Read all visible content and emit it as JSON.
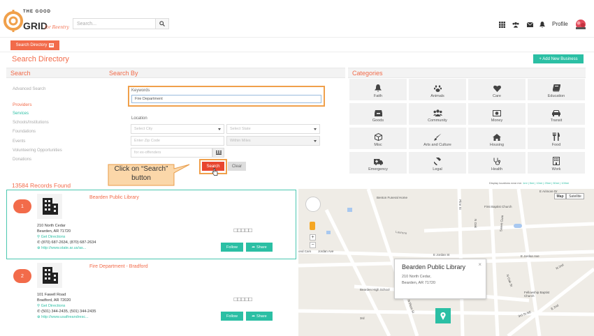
{
  "header": {
    "logo_text_1": "THE GOOD",
    "logo_text_2": "GRID",
    "logo_text_3": "for Reentry",
    "search_placeholder": "Search...",
    "profile_label": "Profile"
  },
  "directory_button": "Search Directory",
  "page_title": "Search Directory",
  "add_business": "+ Add New Business",
  "sections": {
    "search": "Search",
    "search_by": "Search By",
    "categories": "Categories"
  },
  "sidebar": {
    "advanced": "Advanced Search",
    "items": [
      "Providers",
      "Services",
      "Schools/Institutions",
      "Foundations",
      "Events",
      "Volunteering Opportunities",
      "Donations"
    ]
  },
  "form": {
    "keywords_label": "Keywords",
    "keywords_value": "Fire Department",
    "location_label": "Location",
    "city_placeholder": "Select City",
    "state_placeholder": "Select State",
    "zip_placeholder": "Enter Zip Code",
    "miles_placeholder": "Within Miles",
    "exoffenders_placeholder": "for ex-offenders",
    "search_button": "Search",
    "clear_button": "Clear"
  },
  "callout": {
    "line1": "Click on “Search”",
    "line2": "button"
  },
  "categories": [
    {
      "label": "Faith",
      "icon": "bell-icon"
    },
    {
      "label": "Animals",
      "icon": "paw-icon"
    },
    {
      "label": "Care",
      "icon": "heart-icon"
    },
    {
      "label": "Education",
      "icon": "book-icon"
    },
    {
      "label": "Goods",
      "icon": "tray-icon"
    },
    {
      "label": "Community",
      "icon": "group-icon"
    },
    {
      "label": "Money",
      "icon": "money-icon"
    },
    {
      "label": "Transit",
      "icon": "car-icon"
    },
    {
      "label": "Misc",
      "icon": "cube-icon"
    },
    {
      "label": "Arts and Culture",
      "icon": "brush-icon"
    },
    {
      "label": "Housing",
      "icon": "home-icon"
    },
    {
      "label": "Food",
      "icon": "utensils-icon"
    },
    {
      "label": "Emergency",
      "icon": "ambulance-icon"
    },
    {
      "label": "Legal",
      "icon": "gavel-icon"
    },
    {
      "label": "Health",
      "icon": "stethoscope-icon"
    },
    {
      "label": "Work",
      "icon": "building-icon"
    }
  ],
  "display_locations": "Display locations near me:",
  "radius_links": "1mi | 5mi | 10mi | 25mi | 50mi | 100mi",
  "records_found": "13584 Records Found",
  "results": [
    {
      "num": "1",
      "name": "Bearden Public Library",
      "addr1": "210 North Cedar",
      "addr2": "Bearden, AR 71720",
      "directions": "Get Directions",
      "phone": "(870) 687-2634, (870) 687-2634",
      "url": "http://www.state.ar.us/as...",
      "follow": "Follow",
      "share": "Share"
    },
    {
      "num": "2",
      "name": "Fire Department - Bradford",
      "addr1": "101 Fawell Road",
      "addr2": "Bradford, AR 72020",
      "directions": "Get Directions",
      "phone": "(501) 344-2435, (501) 344-2435",
      "url": "http://www.usafireandresc...",
      "follow": "Follow",
      "share": "Share"
    }
  ],
  "map": {
    "map_btn": "Map",
    "satellite_btn": "Satellite",
    "labels": [
      "Benton Funeral Home",
      "First Baptist Church",
      "Laurens",
      "Jordan Ave",
      "E Jordan St",
      "E Jordan Ave",
      "Pine St",
      "Sweet Gum",
      "N Oak",
      "Bearden High School",
      "Fellowship Baptist Church",
      "E Arimore Dr",
      "3rd",
      "E 2nd",
      "N 2nd",
      "N Oak St",
      "N Plum St",
      "3rd St NE",
      "ond Cars"
    ],
    "popup_title": "Bearden Public Library",
    "popup_addr1": "210 North Cedar,",
    "popup_addr2": "Bearden, AR 71720"
  }
}
